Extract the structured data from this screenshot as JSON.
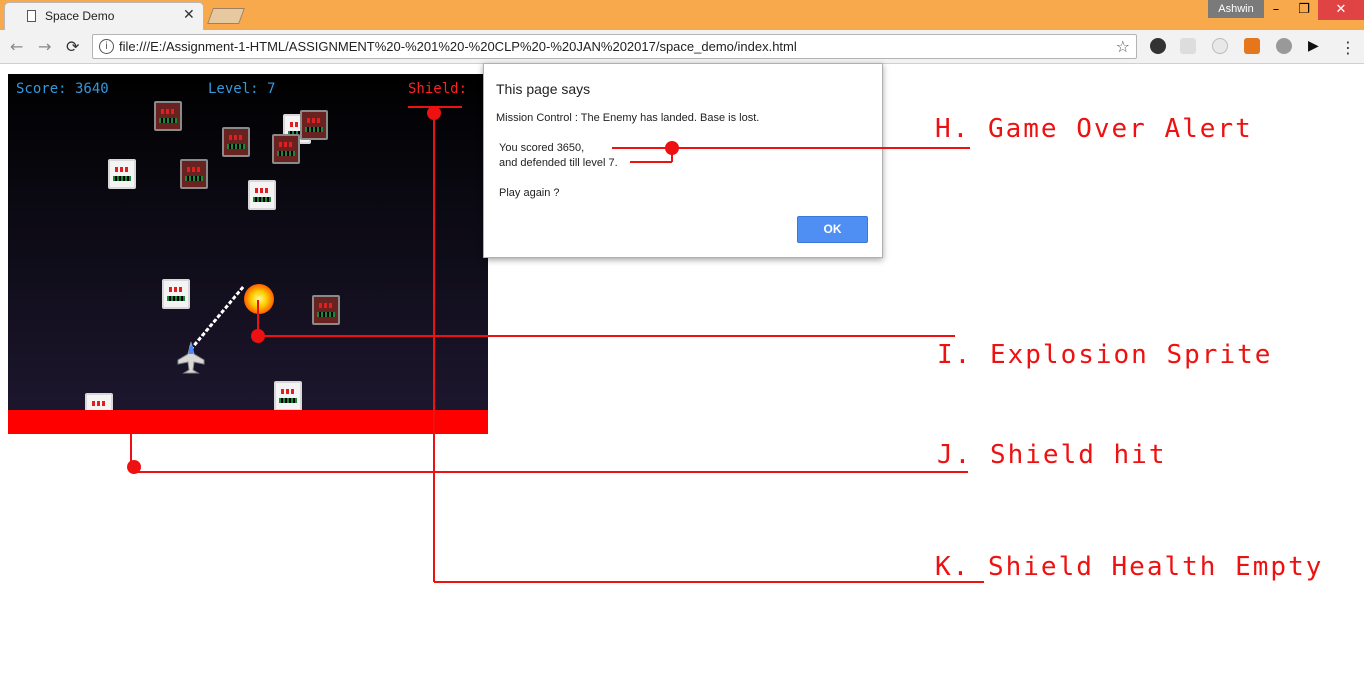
{
  "browser": {
    "tab_title": "Space Demo",
    "profile_name": "Ashwin",
    "url": "file:///E:/Assignment-1-HTML/ASSIGNMENT%20-%201%20-%20CLP%20-%20JAN%202017/space_demo/index.html",
    "window_buttons": [
      "–",
      "❐",
      "✕"
    ]
  },
  "game": {
    "score_text": "Score: 3640",
    "level_text": "Level: 7",
    "shield_text": "Shield:",
    "colors": {
      "hud_blue": "#3399dd",
      "shield_red": "#ff0000"
    }
  },
  "dialog": {
    "title": "This page says",
    "message": "Mission Control : The Enemy has landed. Base is lost.",
    "score_line": "You scored 3650,",
    "level_line": "and defended till level 7.",
    "prompt": "Play again ?",
    "ok_label": "OK"
  },
  "annotations": {
    "h": "H. Game Over Alert",
    "i": "I. Explosion Sprite",
    "j": "J. Shield hit",
    "k": "K. Shield Health Empty"
  }
}
